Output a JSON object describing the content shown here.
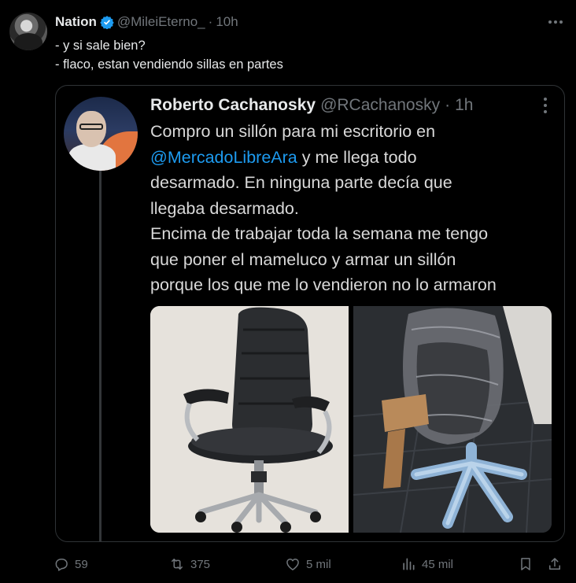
{
  "post": {
    "display_name": "Nation",
    "handle": "@MileiEterno_",
    "separator": "·",
    "time": "10h",
    "lines": [
      "- y si sale bien?",
      "- flaco, estan vendiendo sillas en partes"
    ]
  },
  "quote": {
    "display_name": "Roberto Cachanosky",
    "handle": "@RCachanosky",
    "separator": "·",
    "time": "1h",
    "lines": [
      {
        "pre": "Compro un sillón para mi escritorio en",
        "mention": "",
        "post": ""
      },
      {
        "pre": "",
        "mention": "@MercadoLibreAra",
        "post": " y me llega todo"
      },
      {
        "pre": "desarmado. En ninguna parte decía que",
        "mention": "",
        "post": ""
      },
      {
        "pre": "llegaba desarmado.",
        "mention": "",
        "post": ""
      },
      {
        "pre": "Encima de trabajar toda la semana me tengo",
        "mention": "",
        "post": ""
      },
      {
        "pre": "que poner el mameluco y armar un sillón",
        "mention": "",
        "post": ""
      },
      {
        "pre": "porque los que me lo vendieron no lo armaron",
        "mention": "",
        "post": ""
      }
    ]
  },
  "actions": {
    "replies": "59",
    "reposts": "375",
    "likes": "5 mil",
    "views": "45 mil"
  },
  "colors": {
    "background": "#000000",
    "text": "#e7e9ea",
    "muted": "#71767b",
    "accent": "#1d9bf0",
    "border": "#2f3336"
  },
  "icons": [
    "verified-badge-icon",
    "more-icon",
    "reply-icon",
    "repost-icon",
    "like-icon",
    "views-icon",
    "bookmark-icon",
    "share-icon"
  ]
}
